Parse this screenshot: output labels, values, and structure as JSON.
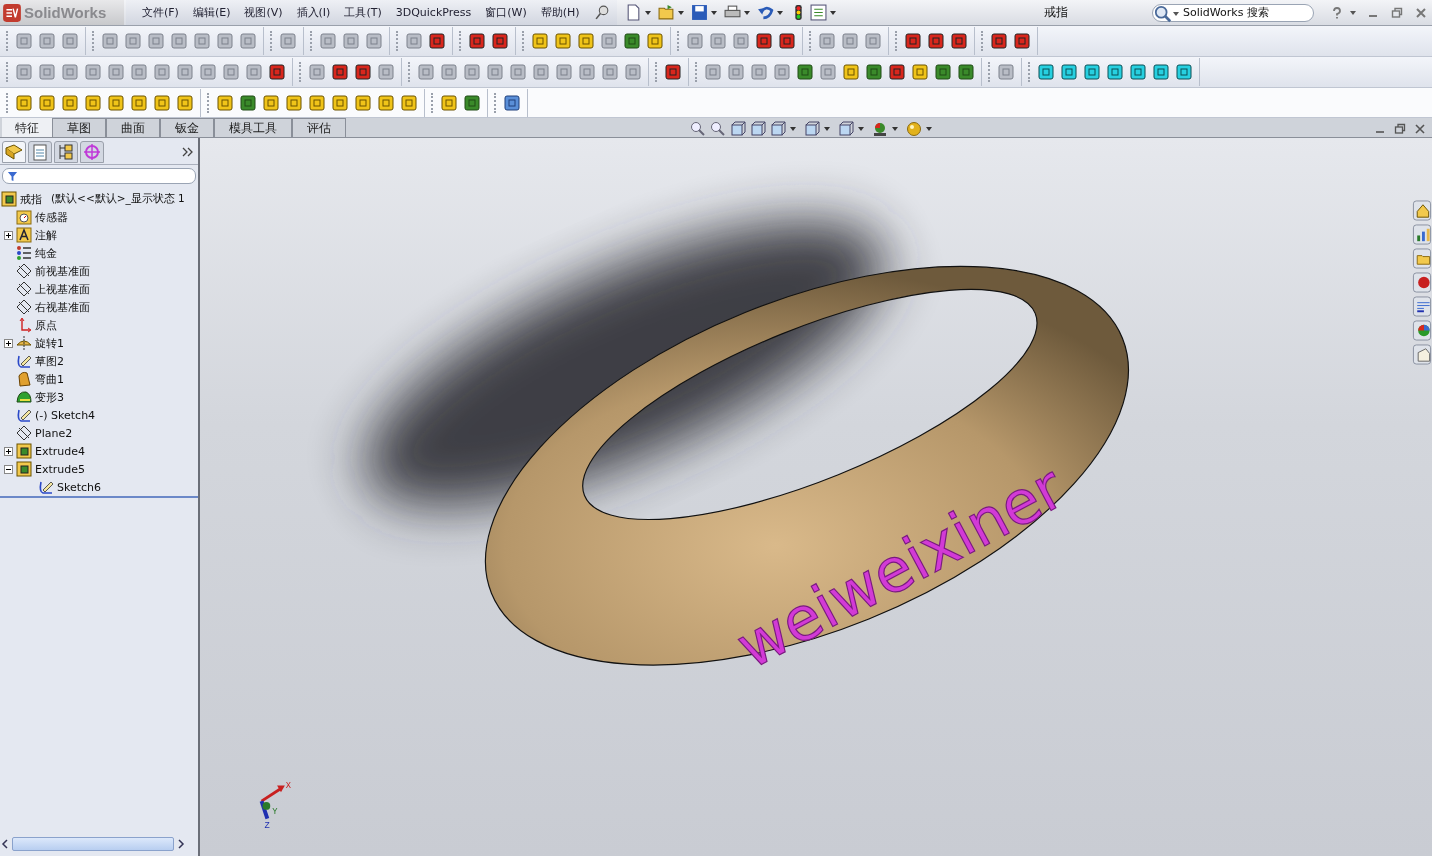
{
  "app": {
    "name": "SolidWorks"
  },
  "menu": [
    "文件(F)",
    "编辑(E)",
    "视图(V)",
    "插入(I)",
    "工具(T)",
    "3DQuickPress",
    "窗口(W)",
    "帮助(H)"
  ],
  "document_title": "戒指",
  "search": {
    "placeholder": "SolidWorks 搜索"
  },
  "command_tabs": [
    {
      "label": "特征",
      "selected": true
    },
    {
      "label": "草图",
      "selected": false
    },
    {
      "label": "曲面",
      "selected": false
    },
    {
      "label": "钣金",
      "selected": false
    },
    {
      "label": "模具工具",
      "selected": false
    },
    {
      "label": "评估",
      "selected": false
    }
  ],
  "feature_tree": {
    "root": {
      "name": "戒指",
      "configuration": "(默认<<默认>_显示状态 1"
    },
    "items": [
      {
        "kind": "sensor",
        "label": "传感器"
      },
      {
        "kind": "annotation",
        "label": "注解",
        "expanded": false
      },
      {
        "kind": "material",
        "label": "纯金"
      },
      {
        "kind": "plane",
        "label": "前视基准面"
      },
      {
        "kind": "plane",
        "label": "上视基准面"
      },
      {
        "kind": "plane",
        "label": "右视基准面"
      },
      {
        "kind": "origin",
        "label": "原点"
      },
      {
        "kind": "revolve",
        "label": "旋转1",
        "expanded": false
      },
      {
        "kind": "sketch",
        "label": "草图2"
      },
      {
        "kind": "flex",
        "label": "弯曲1"
      },
      {
        "kind": "deform",
        "label": "变形3"
      },
      {
        "kind": "sketch",
        "label": "(-) Sketch4"
      },
      {
        "kind": "plane",
        "label": "Plane2"
      },
      {
        "kind": "extrude",
        "label": "Extrude4",
        "expanded": false
      },
      {
        "kind": "extrude",
        "label": "Extrude5",
        "expanded": true,
        "children": [
          {
            "kind": "sketch",
            "label": "Sketch6"
          }
        ]
      }
    ]
  },
  "model": {
    "engraving": "weiweixiner"
  },
  "triad": {
    "x": "X",
    "y": "Y",
    "z": "Z"
  }
}
